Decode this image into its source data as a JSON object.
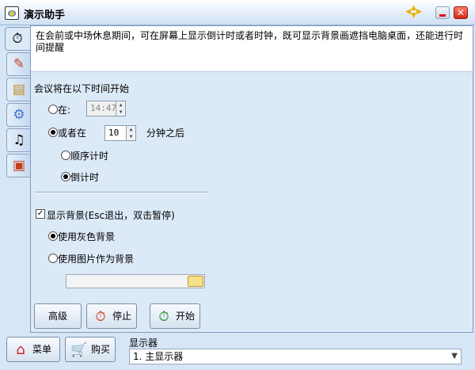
{
  "window": {
    "title": "演示助手"
  },
  "description": "在会前或中场休息期间，可在屏幕上显示倒计时或者时钟，既可显示背景画遮挡电脑桌面，还能进行时间提醒",
  "start": {
    "heading": "会议将在以下时间开始",
    "at_label": "在:",
    "at_time": "14:47",
    "after_label": "或者在",
    "after_value": "10",
    "after_suffix": "分钟之后",
    "mode_forward": "顺序计时",
    "mode_countdown": "倒计时"
  },
  "background": {
    "show_label": "显示背景(Esc退出，双击暂停)",
    "gray_label": "使用灰色背景",
    "image_label": "使用图片作为背景",
    "file_value": ""
  },
  "buttons": {
    "advanced": "高级",
    "stop": "停止",
    "start": "开始"
  },
  "bottom": {
    "menu": "菜单",
    "buy": "购买",
    "display_label": "显示器",
    "display_value": "1. 主显示器"
  }
}
